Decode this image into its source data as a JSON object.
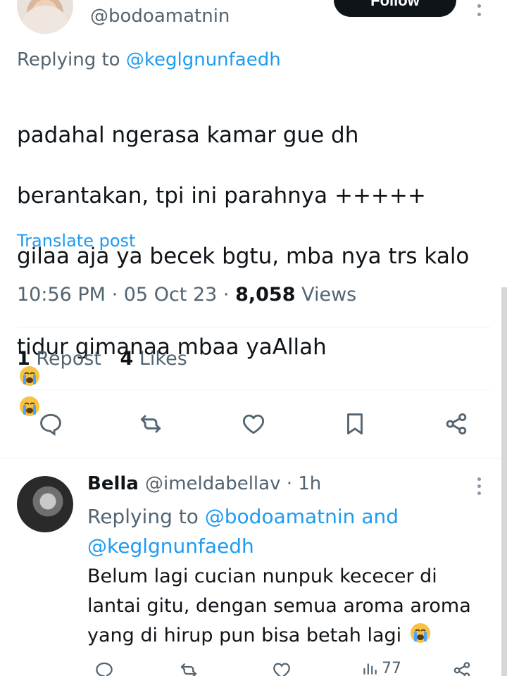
{
  "header": {
    "handle": "@bodoamatnin",
    "follow_label": "Follow"
  },
  "tweet": {
    "replying_prefix": "Replying to",
    "replying_to": "@keglgnunfaedh",
    "text_line1": "padahal ngerasa kamar gue dh",
    "text_line2": "berantakan, tpi ini parahnya +++++",
    "text_line3": "gilaa aja ya becek bgtu, mba nya trs kalo",
    "text_line4": "tidur gimanaa mbaa yaAllah",
    "translate_label": "Translate post",
    "time": "10:56 PM",
    "date": "05 Oct 23",
    "views_count": "8,058",
    "views_label": "Views",
    "reposts_count": "1",
    "reposts_label": "Repost",
    "likes_count": "4",
    "likes_label": "Likes"
  },
  "reply": {
    "name": "Bella",
    "handle_time": "@imeldabellav · 1h",
    "replying_prefix": "Replying to",
    "replying_to_1": "@bodoamatnin",
    "and": "and",
    "replying_to_2": "@keglgnunfaedh",
    "text_line1": "Belum lagi cucian nunpuk kececer di",
    "text_line2": "lantai gitu, dengan semua aroma aroma",
    "text_line3": "yang di hirup pun bisa betah lagi",
    "views": "77"
  },
  "icons": {
    "reply": "reply-icon",
    "repost": "repost-icon",
    "like": "heart-icon",
    "bookmark": "bookmark-icon",
    "share": "share-icon",
    "more": "more-vertical-icon",
    "emoji": "crying-face-emoji"
  },
  "colors": {
    "primary_text": "#0f1419",
    "secondary_text": "#536471",
    "accent": "#1d9bf0",
    "divider": "#eff3f4"
  }
}
